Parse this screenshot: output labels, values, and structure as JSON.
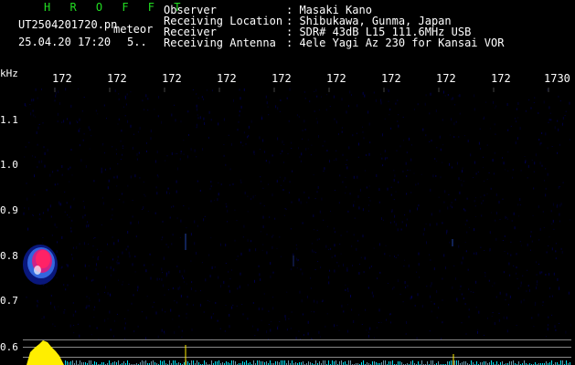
{
  "header": {
    "software": "H R O F F T",
    "filename": "UT2504201720.pn",
    "mode": "meteor",
    "datetime": "25.04.20 17:20",
    "extra": "5..",
    "rows": [
      {
        "label": "Observer",
        "value": ": Masaki Kano"
      },
      {
        "label": "Receiving Location",
        "value": ": Shibukawa, Gunma, Japan"
      },
      {
        "label": "Receiver",
        "value": ": SDR# 43dB L15 111.6MHz USB"
      },
      {
        "label": "Receiving Antenna",
        "value": ": 4ele Yagi Az 230 for Kansai VOR"
      }
    ]
  },
  "axis": {
    "y_unit": "kHz",
    "x_ticks": [
      "172",
      "172",
      "172",
      "172",
      "172",
      "172",
      "172",
      "172",
      "172",
      "1730"
    ],
    "y_ticks": [
      "1.1",
      "1.0",
      "0.9",
      "0.8",
      "0.7",
      "0.6"
    ]
  },
  "colors": {
    "background": "#000000",
    "header_green": "#22dd22",
    "echo_core": "#ff2266",
    "spectrum": "#ffee00",
    "spectrum_cyan": "#00ddee"
  }
}
